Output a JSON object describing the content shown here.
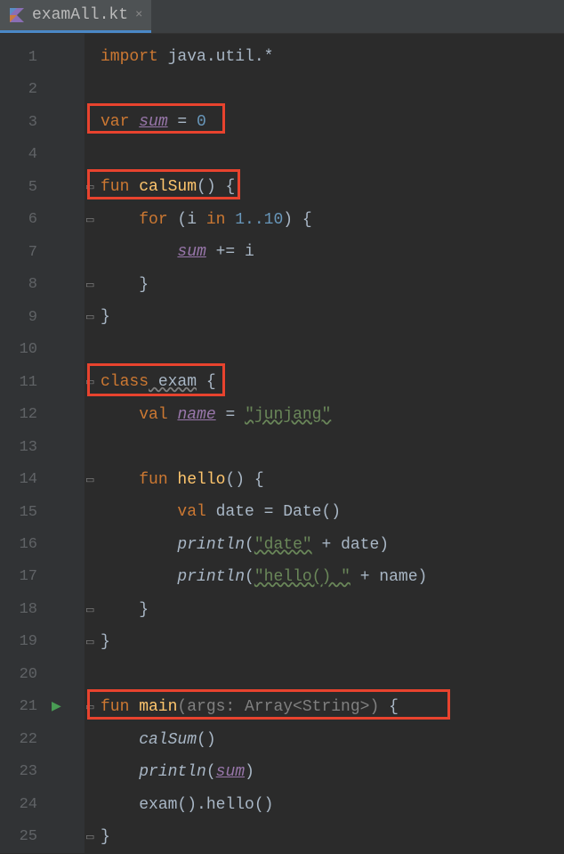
{
  "tab": {
    "filename": "examAll.kt",
    "close": "×"
  },
  "lines": {
    "nums": [
      "1",
      "2",
      "3",
      "4",
      "5",
      "6",
      "7",
      "8",
      "9",
      "10",
      "11",
      "12",
      "13",
      "14",
      "15",
      "16",
      "17",
      "18",
      "19",
      "20",
      "21",
      "22",
      "23",
      "24",
      "25"
    ]
  },
  "code": {
    "l1": {
      "import": "import",
      "pkg": " java.util.*"
    },
    "l3": {
      "var": "var",
      "sum": "sum",
      "eq": " = ",
      "zero": "0"
    },
    "l5": {
      "fun": "fun",
      "name": " calSum",
      "paren": "()",
      "brace": " {"
    },
    "l6": {
      "for": "for",
      "sp": " (i ",
      "in": "in",
      "range": " 1..10",
      "bclose": ") {"
    },
    "l7": {
      "sum": "sum",
      "op": " += i"
    },
    "l8": {
      "close": "}"
    },
    "l9": {
      "close": "}"
    },
    "l11": {
      "class": "class",
      "name": " exam",
      "brace": " {"
    },
    "l12": {
      "val": "val",
      "sp": " ",
      "name": "name",
      "eq": " = ",
      "str": "\"junjang\""
    },
    "l14": {
      "fun": "fun",
      "name": " hello",
      "paren": "()",
      "brace": " {"
    },
    "l15": {
      "val": "val",
      "sp": " date = Date()"
    },
    "l16": {
      "fn": "println",
      "open": "(",
      "str": "\"date\"",
      "plus": " + date)"
    },
    "l17": {
      "fn": "println",
      "open": "(",
      "str": "\"hello() \"",
      "plus": " + name)"
    },
    "l18": {
      "close": "}"
    },
    "l19": {
      "close": "}"
    },
    "l21": {
      "fun": "fun",
      "name": " main",
      "params": "(args: Array<String>)",
      "brace": " {"
    },
    "l22": {
      "fn": "calSum",
      "paren": "()"
    },
    "l23": {
      "fn": "println",
      "open": "(",
      "sum": "sum",
      "close": ")"
    },
    "l24": {
      "txt": "exam().hello()"
    },
    "l25": {
      "close": "}"
    }
  }
}
